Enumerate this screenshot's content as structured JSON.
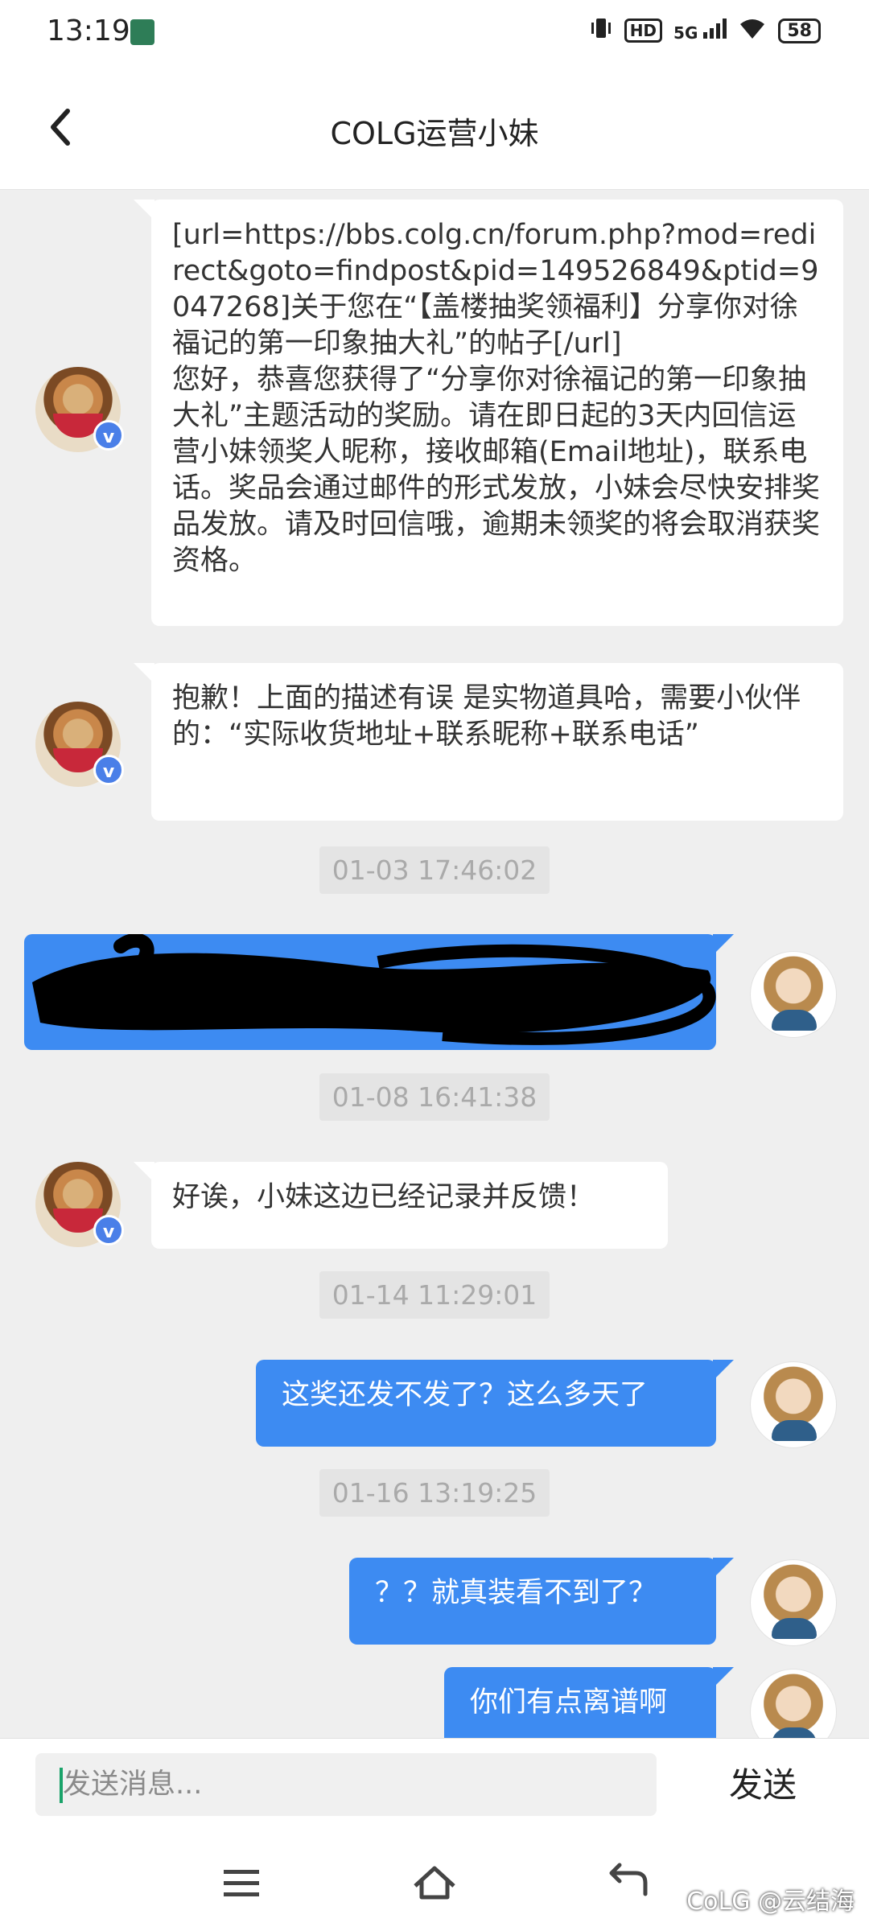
{
  "status_bar": {
    "time": "13:19",
    "hd": "HD",
    "network": "5G",
    "battery": "58"
  },
  "header": {
    "title": "COLG运营小妹"
  },
  "messages": [
    {
      "kind": "in",
      "text": "[url=https://bbs.colg.cn/forum.php?mod=redirect&goto=findpost&pid=149526849&ptid=9047268]关于您在“【盖楼抽奖领福利】分享你对徐福记的第一印象抽大礼”的帖子[/url]\n您好，恭喜您获得了“分享你对徐福记的第一印象抽大礼”主题活动的奖励。请在即日起的3天内回信运营小妹领奖人昵称，接收邮箱(Email地址)，联系电话。奖品会通过邮件的形式发放，小妹会尽快安排奖品发放。请及时回信哦，逾期未领奖的将会取消获奖资格。"
    },
    {
      "kind": "in",
      "text": "抱歉！上面的描述有误 是实物道具哈，需要小伙伴的：“实际收货地址+联系昵称+联系电话”"
    },
    {
      "kind": "time",
      "text": "01-03 17:46:02"
    },
    {
      "kind": "out-redacted"
    },
    {
      "kind": "time",
      "text": "01-08 16:41:38"
    },
    {
      "kind": "in",
      "text": "好诶，小妹这边已经记录并反馈！"
    },
    {
      "kind": "time",
      "text": "01-14 11:29:01"
    },
    {
      "kind": "out",
      "text": "这奖还发不发了？这么多天了"
    },
    {
      "kind": "time",
      "text": "01-16 13:19:25"
    },
    {
      "kind": "out",
      "text": "？？就真装看不到了？"
    },
    {
      "kind": "out",
      "text": "你们有点离谱啊"
    }
  ],
  "input": {
    "placeholder": "发送消息...",
    "send_label": "发送"
  },
  "avatars": {
    "verified_badge": "v"
  },
  "watermark": "CoLG @云结海",
  "colors": {
    "outgoing_bubble": "#3d8bf2",
    "incoming_bubble": "#ffffff",
    "background": "#efefef",
    "verified_badge": "#4a7fe8"
  }
}
